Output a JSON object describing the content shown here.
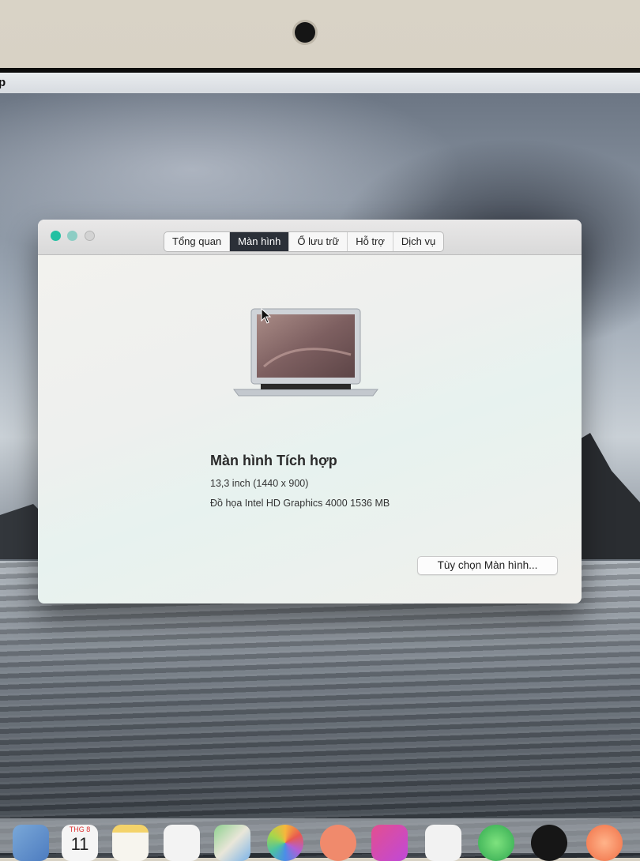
{
  "menubar": {
    "app_fragment": "p"
  },
  "window": {
    "tabs": [
      "Tổng quan",
      "Màn hình",
      "Ổ lưu trữ",
      "Hỗ trợ",
      "Dịch vụ"
    ],
    "active_tab": "Màn hình",
    "display_name": "Màn hình Tích hợp",
    "size_line": "13,3 inch (1440 x 900)",
    "graphics_line": "Đồ họa Intel HD Graphics 4000 1536 MB",
    "options_button": "Tùy chọn Màn hình..."
  },
  "dock": {
    "calendar_month": "THG 8",
    "calendar_day": "11",
    "icons": [
      "finder-icon",
      "calendar-icon",
      "notes-icon",
      "reminders-icon",
      "maps-icon",
      "photos-icon",
      "facetime-icon",
      "music-icon",
      "podcasts-icon",
      "tv-icon",
      "app-store-icon"
    ]
  }
}
